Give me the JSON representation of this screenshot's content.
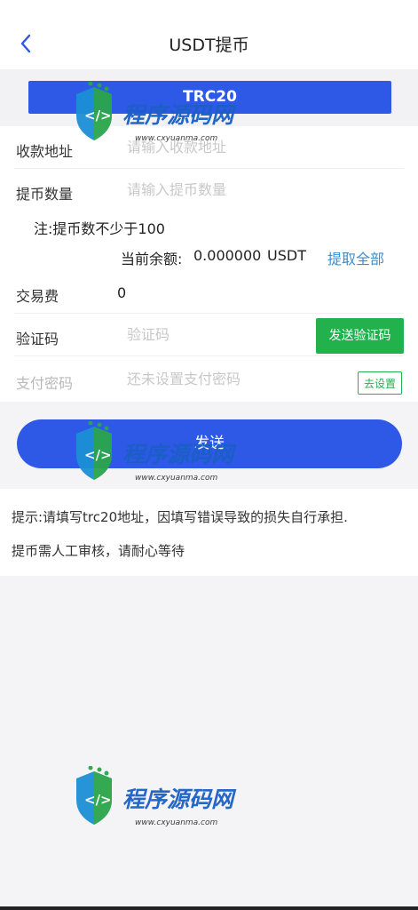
{
  "header": {
    "title": "USDT提币"
  },
  "chain": {
    "label": "TRC20"
  },
  "form": {
    "address": {
      "label": "收款地址",
      "placeholder": "请输入收款地址"
    },
    "amount": {
      "label": "提币数量",
      "placeholder": "请输入提币数量"
    },
    "note": "注:提币数不少于100",
    "balance": {
      "label": "当前余额:",
      "value": "0.000000",
      "unit": "USDT",
      "withdraw_all": "提取全部"
    },
    "fee": {
      "label": "交易费",
      "value": "0"
    },
    "code": {
      "label": "验证码",
      "placeholder": "验证码",
      "send_button": "发送验证码"
    },
    "password": {
      "label": "支付密码",
      "placeholder": "还未设置支付密码",
      "set_button": "去设置"
    }
  },
  "submit": {
    "label": "发送"
  },
  "tips": {
    "line1": "提示:请填写trc20地址，因填写错误导致的损失自行承担.",
    "line2": "提币需人工审核，请耐心等待"
  },
  "watermark": {
    "brand": "程序源码网",
    "url": "www.cxyuanma.com"
  },
  "colors": {
    "primary": "#2e58e6",
    "green": "#22b14c",
    "link": "#3a8fd0"
  }
}
